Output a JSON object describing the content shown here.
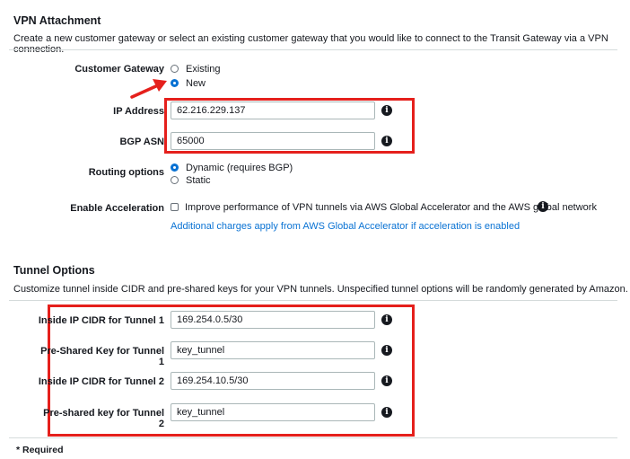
{
  "vpn": {
    "title": "VPN Attachment",
    "description": "Create a new customer gateway or select an existing customer gateway that you would like to connect to the Transit Gateway via a VPN connection.",
    "customer_gateway_label": "Customer Gateway",
    "option_existing": "Existing",
    "option_new": "New",
    "ip_label": "IP Address",
    "ip_value": "62.216.229.137",
    "bgp_label": "BGP ASN",
    "bgp_value": "65000",
    "routing_label": "Routing options",
    "routing_dynamic": "Dynamic (requires BGP)",
    "routing_static": "Static",
    "accel_label": "Enable Acceleration",
    "accel_option": "Improve performance of VPN tunnels via AWS Global Accelerator and the AWS global network",
    "accel_note": "Additional charges apply from AWS Global Accelerator if acceleration is enabled"
  },
  "tunnel": {
    "title": "Tunnel Options",
    "description": "Customize tunnel inside CIDR and pre-shared keys for your VPN tunnels. Unspecified tunnel options will be randomly generated by Amazon.",
    "cidr1_label": "Inside IP CIDR for Tunnel 1",
    "cidr1_value": "169.254.0.5/30",
    "key1_label": "Pre-Shared Key for Tunnel 1",
    "key1_value": "key_tunnel",
    "cidr2_label": "Inside IP CIDR for Tunnel 2",
    "cidr2_value": "169.254.10.5/30",
    "key2_label": "Pre-shared key for Tunnel 2",
    "key2_value": "key_tunnel"
  },
  "footer": {
    "required": "* Required"
  },
  "info_glyph": "i",
  "colors": {
    "highlight": "#e5201c",
    "link": "#0972d3",
    "radio_selected": "#0972d3"
  }
}
